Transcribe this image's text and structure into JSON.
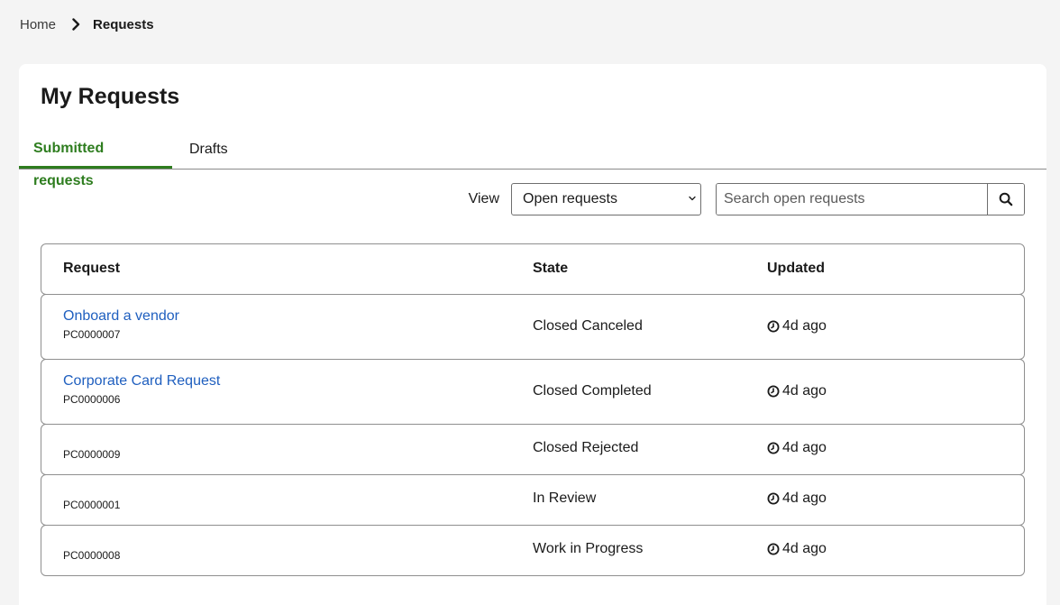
{
  "breadcrumb": {
    "home": "Home",
    "current": "Requests"
  },
  "page": {
    "title": "My Requests"
  },
  "tabs": [
    {
      "label": "Submitted requests",
      "active": true
    },
    {
      "label": "Drafts",
      "active": false
    }
  ],
  "filters": {
    "view_label": "View",
    "view_selected": "Open requests",
    "search_placeholder": "Search open requests"
  },
  "table": {
    "columns": [
      "Request",
      "State",
      "Updated"
    ],
    "rows": [
      {
        "title": "Onboard a vendor",
        "number": "PC0000007",
        "state": "Closed Canceled",
        "updated": "4d ago"
      },
      {
        "title": "Corporate Card Request",
        "number": "PC0000006",
        "state": "Closed Completed",
        "updated": "4d ago"
      },
      {
        "title": "",
        "number": "PC0000009",
        "state": "Closed Rejected",
        "updated": "4d ago"
      },
      {
        "title": "",
        "number": "PC0000001",
        "state": "In Review",
        "updated": "4d ago"
      },
      {
        "title": "",
        "number": "PC0000008",
        "state": "Work in Progress",
        "updated": "4d ago"
      }
    ]
  },
  "colors": {
    "accent_green": "#2e7d1f",
    "link_blue": "#1f5fbf",
    "page_bg": "#f4f4f4"
  },
  "icons": {
    "breadcrumb_separator": "chevron-right-icon",
    "select_arrow": "chevron-down-icon",
    "search": "search-icon",
    "updated": "clock-icon"
  }
}
